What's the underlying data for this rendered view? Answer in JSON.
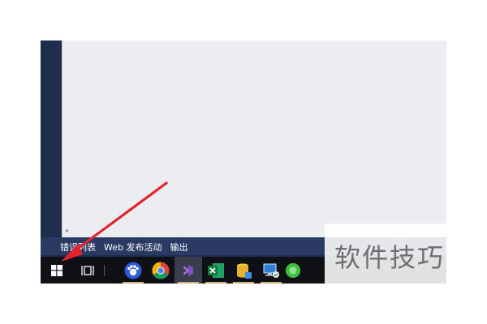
{
  "editor": {
    "scroll_marker": "◂"
  },
  "bottom_panel": {
    "tabs": [
      {
        "label": "错误列表"
      },
      {
        "label": "Web 发布活动"
      },
      {
        "label": "输出"
      }
    ]
  },
  "taskbar": {
    "items": [
      {
        "name": "start-button",
        "icon": "windows-logo-icon"
      },
      {
        "name": "task-view-button",
        "icon": "task-view-icon"
      },
      {
        "name": "taskbar-app-baidu",
        "icon": "baidu-paw-icon",
        "open": true
      },
      {
        "name": "taskbar-app-chrome",
        "icon": "chrome-icon",
        "open": false
      },
      {
        "name": "taskbar-app-visual-studio",
        "icon": "visual-studio-icon",
        "open": true,
        "active": true
      },
      {
        "name": "taskbar-app-excel",
        "icon": "excel-icon",
        "open": true
      },
      {
        "name": "taskbar-app-database",
        "icon": "database-icon",
        "open": true
      },
      {
        "name": "taskbar-app-remote",
        "icon": "computer-sync-icon",
        "open": true
      },
      {
        "name": "taskbar-app-green",
        "icon": "green-circle-icon",
        "open": false
      }
    ]
  },
  "colors": {
    "vs_sidebar": "#1f2d4e",
    "editor_bg": "#ecedf0",
    "taskbar": "#0e1016",
    "annotation_arrow": "#e3232c",
    "open_indicator": "#c9b27a"
  },
  "watermark": {
    "text": "软件技巧"
  }
}
